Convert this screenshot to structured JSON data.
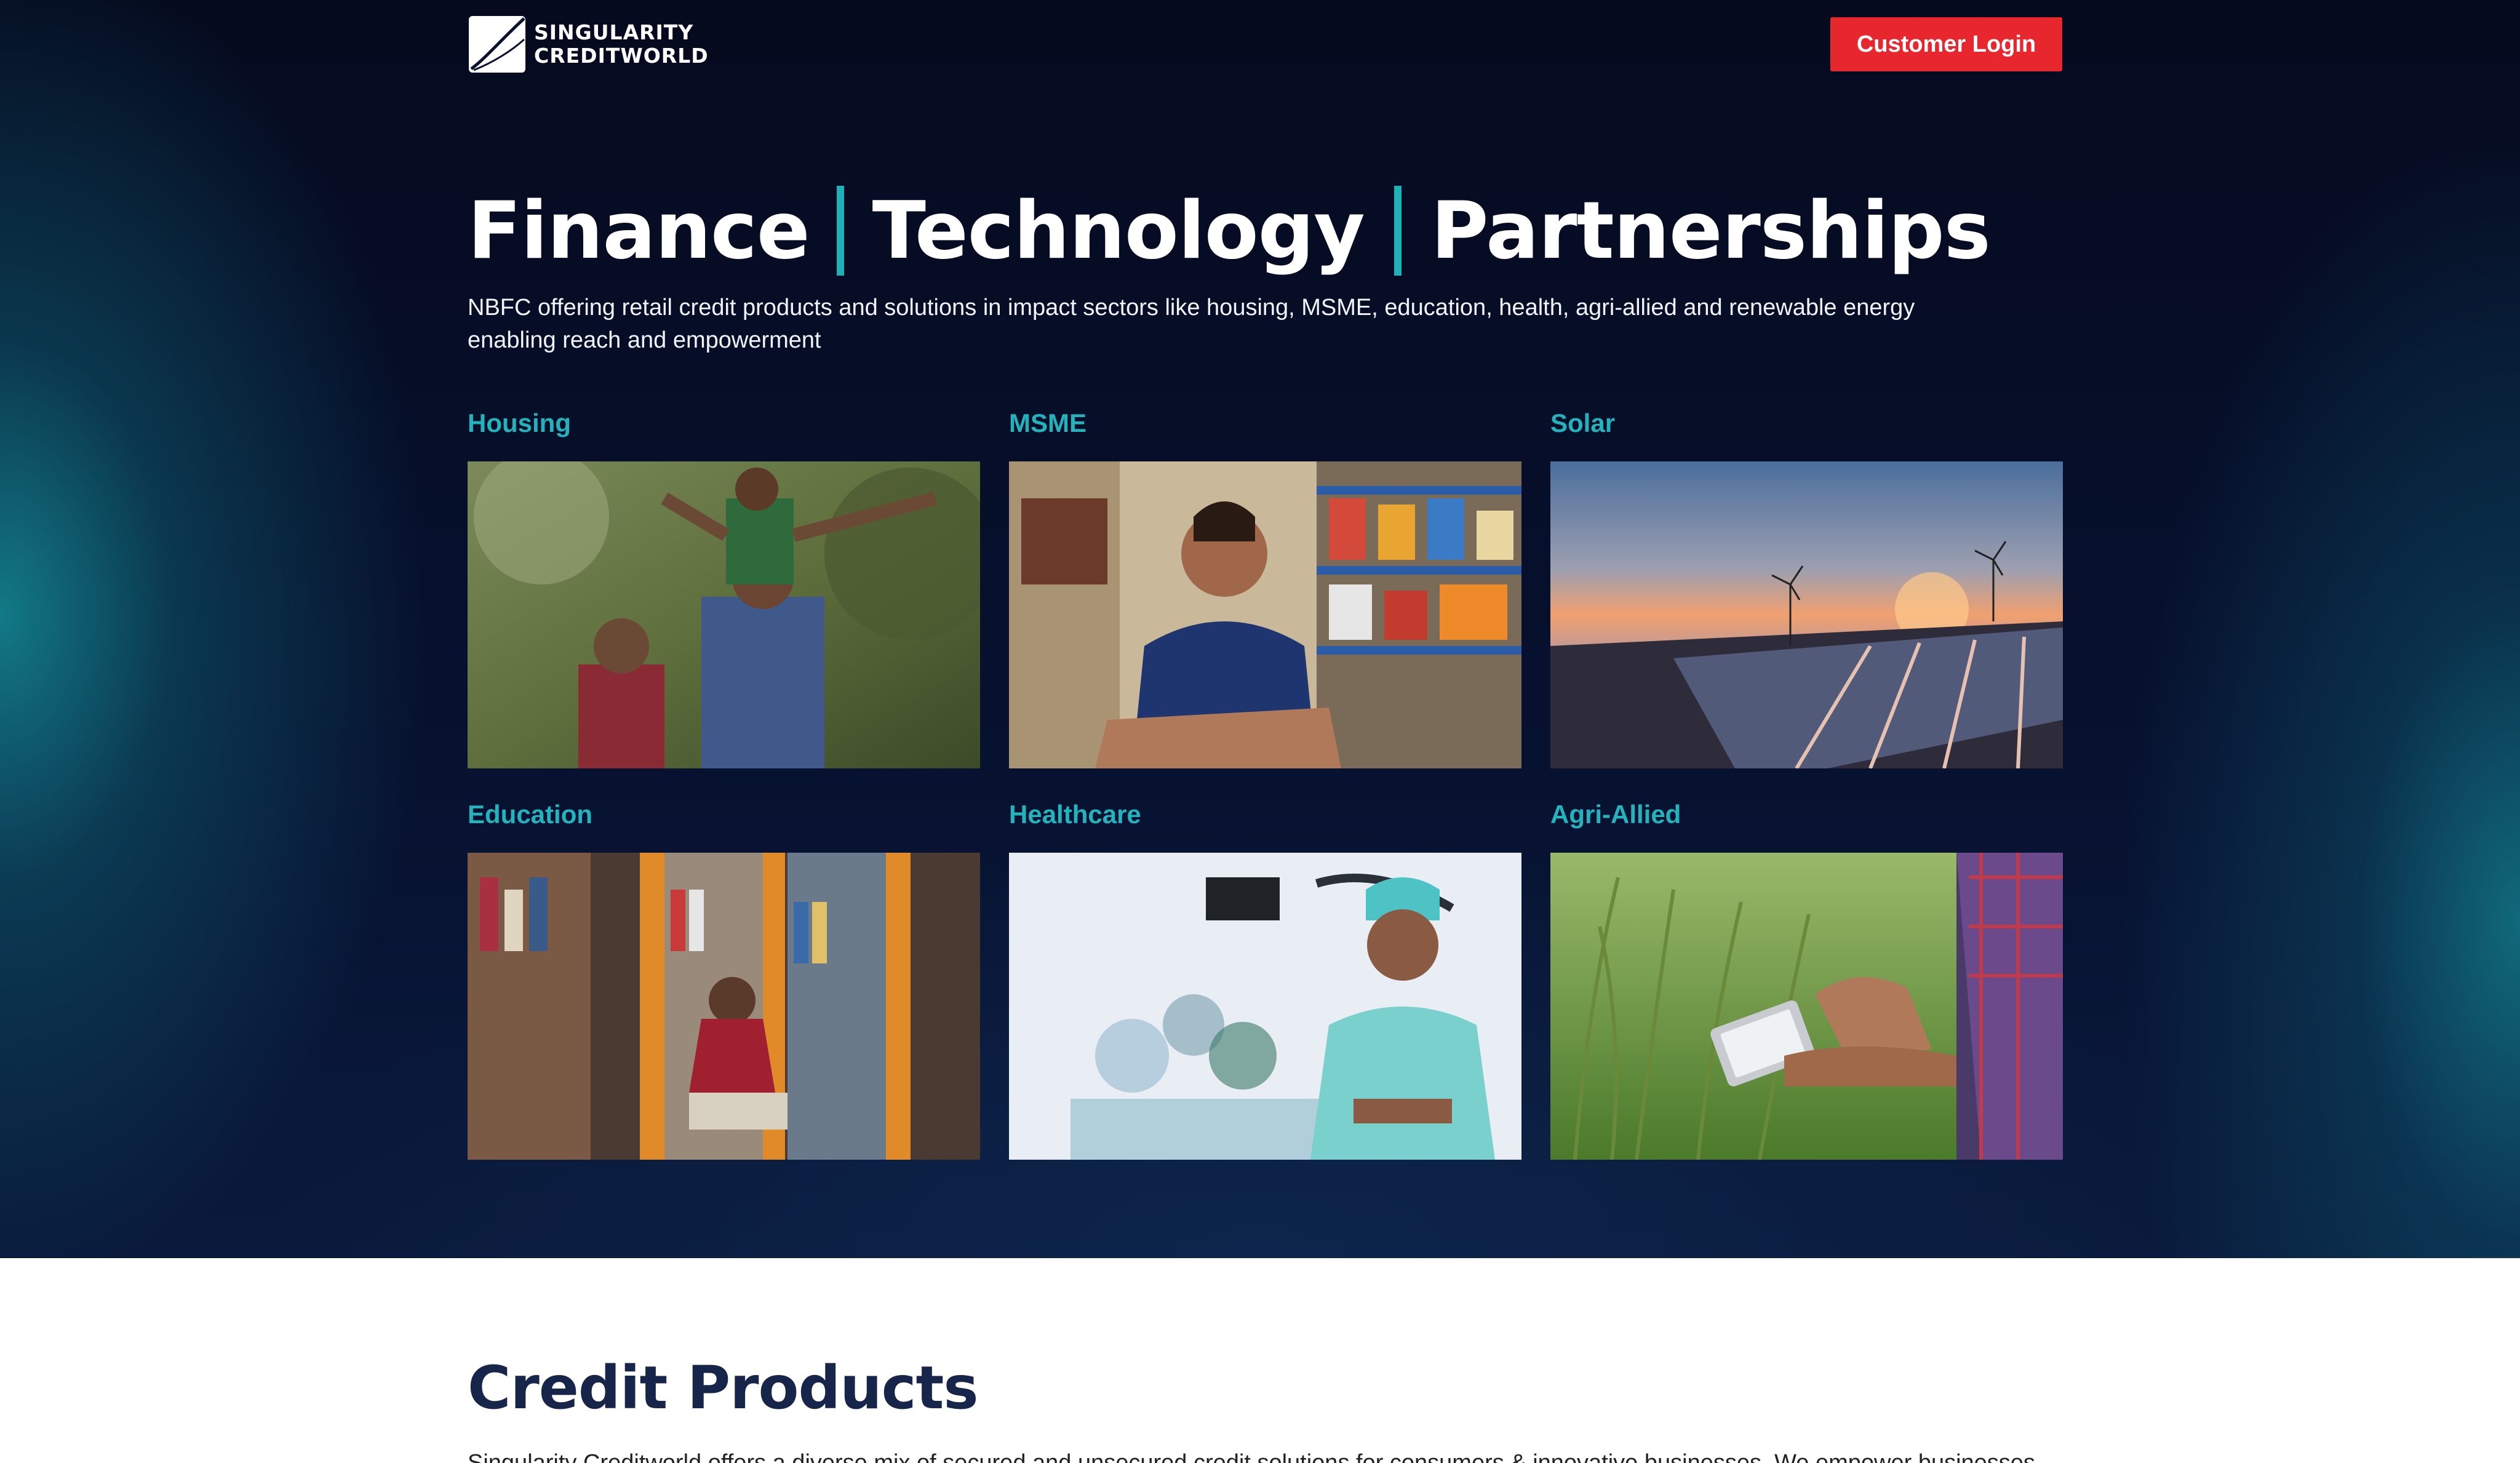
{
  "header": {
    "logo_line1": "SINGULARITY",
    "logo_line2": "CREDITWORLD",
    "login_label": "Customer Login"
  },
  "hero": {
    "headline_words": [
      "Finance",
      "Technology",
      "Partnerships"
    ],
    "intro": "NBFC offering retail credit products and solutions in impact sectors like housing, MSME, education, health, agri-allied and renewable energy enabling reach and empowerment",
    "sectors": [
      {
        "label": "Housing"
      },
      {
        "label": "MSME"
      },
      {
        "label": "Solar"
      },
      {
        "label": "Education"
      },
      {
        "label": "Healthcare"
      },
      {
        "label": "Agri-Allied"
      }
    ]
  },
  "credit_products": {
    "title": "Credit Products",
    "text": "Singularity Creditworld offers a diverse mix of secured and unsecured credit solutions for consumers & innovative businesses. We empower businesses"
  },
  "colors": {
    "accent": "#1fb0b8",
    "login_button": "#e8262e",
    "hero_bg": "#071130",
    "title_dark": "#18254a"
  }
}
